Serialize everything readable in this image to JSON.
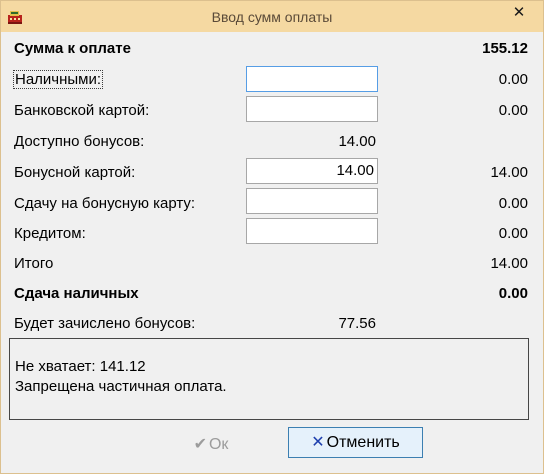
{
  "window": {
    "title": "Ввод сумм оплаты",
    "close_symbol": "✕",
    "icon": "cash-register-icon"
  },
  "rows": {
    "total_due": {
      "label": "Сумма к оплате",
      "value": "155.12"
    },
    "cash": {
      "label": "Наличными:",
      "input_value": "",
      "amount": "0.00"
    },
    "bank_card": {
      "label": "Банковской картой:",
      "input_value": "",
      "amount": "0.00"
    },
    "bonus_available": {
      "label": "Доступно бонусов:",
      "value": "14.00"
    },
    "bonus_card": {
      "label": "Бонусной картой:",
      "input_value": "14.00",
      "amount": "14.00"
    },
    "change_to_bonus": {
      "label": "Сдачу на бонусную карту:",
      "input_value": "",
      "amount": "0.00"
    },
    "credit": {
      "label": "Кредитом:",
      "input_value": "",
      "amount": "0.00"
    },
    "total": {
      "label": "Итого",
      "amount": "14.00"
    },
    "cash_change": {
      "label": "Сдача наличных",
      "amount": "0.00"
    },
    "bonus_accrual": {
      "label": "Будет зачислено бонусов:",
      "value": "77.56"
    }
  },
  "messages": {
    "line1": "Не хватает: 141.12",
    "line2": "Запрещена частичная оплата."
  },
  "buttons": {
    "ok": {
      "label": "Ок",
      "icon": "✔",
      "enabled": false
    },
    "cancel": {
      "label": "Отменить",
      "icon": "✕",
      "enabled": true
    }
  },
  "colors": {
    "titlebar": "#f5d9a2",
    "window_border": "#dcc08e",
    "client_bg": "#f0f0f0",
    "focus_border": "#569de5",
    "cancel_icon": "#1e3fae"
  }
}
